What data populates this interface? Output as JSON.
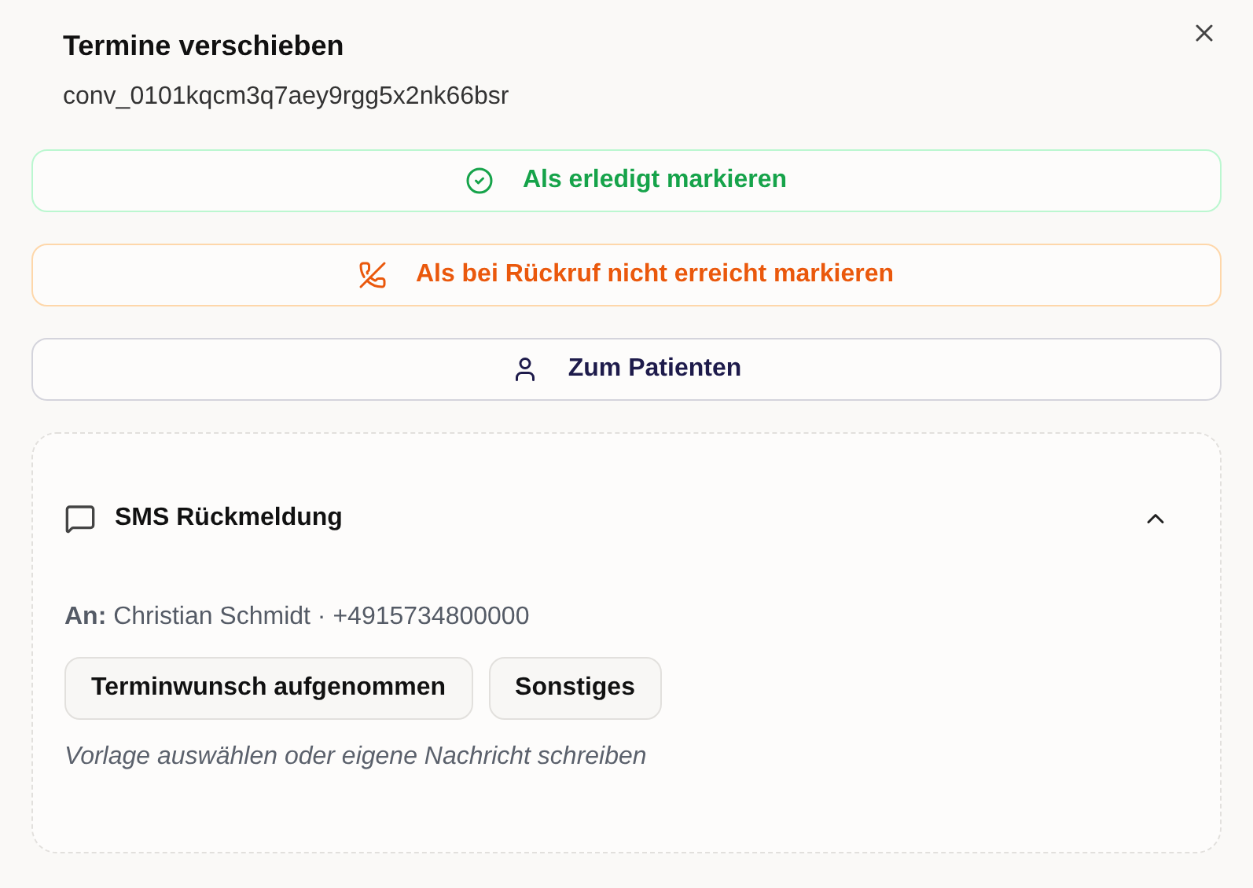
{
  "dialog": {
    "title": "Termine verschieben",
    "subtitle": "conv_0101kqcm3q7aey9rgg5x2nk66bsr"
  },
  "actions": [
    {
      "kind": "success",
      "label": "Als erledigt markieren"
    },
    {
      "kind": "warning",
      "label": "Als bei Rückruf nicht erreicht markieren"
    },
    {
      "kind": "neutral",
      "label": "Zum Patienten"
    }
  ],
  "sms": {
    "title": "SMS Rückmeldung",
    "expanded": true,
    "recipient": "**An:** Christian Schmidt · +4915734800000",
    "templates": [
      "Terminwunsch aufgenommen",
      "Sonstiges"
    ],
    "message": {
      "placeholder": "Vorlage auswählen oder eigene Nachricht schreiben"
    }
  }
}
